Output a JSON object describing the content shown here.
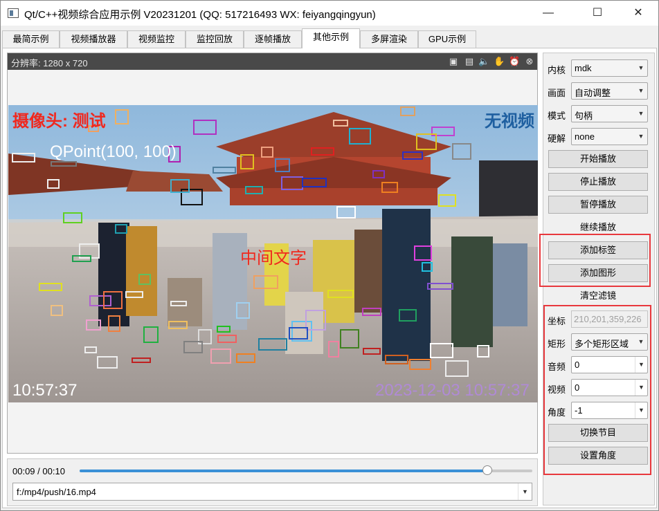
{
  "window": {
    "title": "Qt/C++视频综合应用示例 V20231201 (QQ: 517216493 WX: feiyangqingyun)",
    "minimize_icon": "minimize-icon",
    "maximize_icon": "maximize-icon",
    "close_icon": "close-icon"
  },
  "tabs": [
    {
      "label": "最简示例",
      "active": false
    },
    {
      "label": "视频播放器",
      "active": false
    },
    {
      "label": "视频监控",
      "active": false
    },
    {
      "label": "监控回放",
      "active": false
    },
    {
      "label": "逐帧播放",
      "active": false
    },
    {
      "label": "其他示例",
      "active": true
    },
    {
      "label": "多屏渲染",
      "active": false
    },
    {
      "label": "GPU示例",
      "active": false
    }
  ],
  "video": {
    "resolution_label": "分辨率: 1280 x 720",
    "header_icons": [
      "record-icon",
      "snapshot-icon",
      "sound-icon",
      "hand-icon",
      "alarm-icon",
      "close-icon"
    ],
    "osd": {
      "top_left": "摄像头: 测试",
      "top_right": "无视频",
      "point_text": "QPoint(100, 100)",
      "center_text": "中间文字",
      "bottom_left": "10:57:37",
      "bottom_right": "2023-12-03 10:57:37"
    },
    "colors": {
      "osd_red": "#f0281e",
      "osd_blue": "#1e5fa0",
      "osd_white": "#ffffff",
      "osd_purple": "#b08ad6"
    }
  },
  "controls": {
    "time_current": "00:09",
    "time_total": "00:10",
    "time_separator": " / ",
    "progress": 0.9,
    "url": "f:/mp4/push/16.mp4"
  },
  "side": {
    "core_label": "内核",
    "core_value": "mdk",
    "picture_label": "画面",
    "picture_value": "自动调整",
    "mode_label": "模式",
    "mode_value": "句柄",
    "hwdec_label": "硬解",
    "hwdec_value": "none",
    "start_button": "开始播放",
    "stop_button": "停止播放",
    "pause_button": "暂停播放",
    "resume_button": "继续播放",
    "add_label_button": "添加标签",
    "add_shape_button": "添加图形",
    "clear_filter_button": "清空滤镜",
    "coord_label": "坐标",
    "coord_value": "210,201,359,226",
    "rect_label": "矩形",
    "rect_value": "多个矩形区域",
    "audio_label": "音频",
    "audio_value": "0",
    "video_label": "视频",
    "video_value": "0",
    "angle_label": "角度",
    "angle_value": "-1",
    "switch_program_button": "切换节目",
    "set_angle_button": "设置角度"
  },
  "accent": {
    "highlight_red": "#e8383d",
    "progress_blue": "#3a90d6"
  }
}
